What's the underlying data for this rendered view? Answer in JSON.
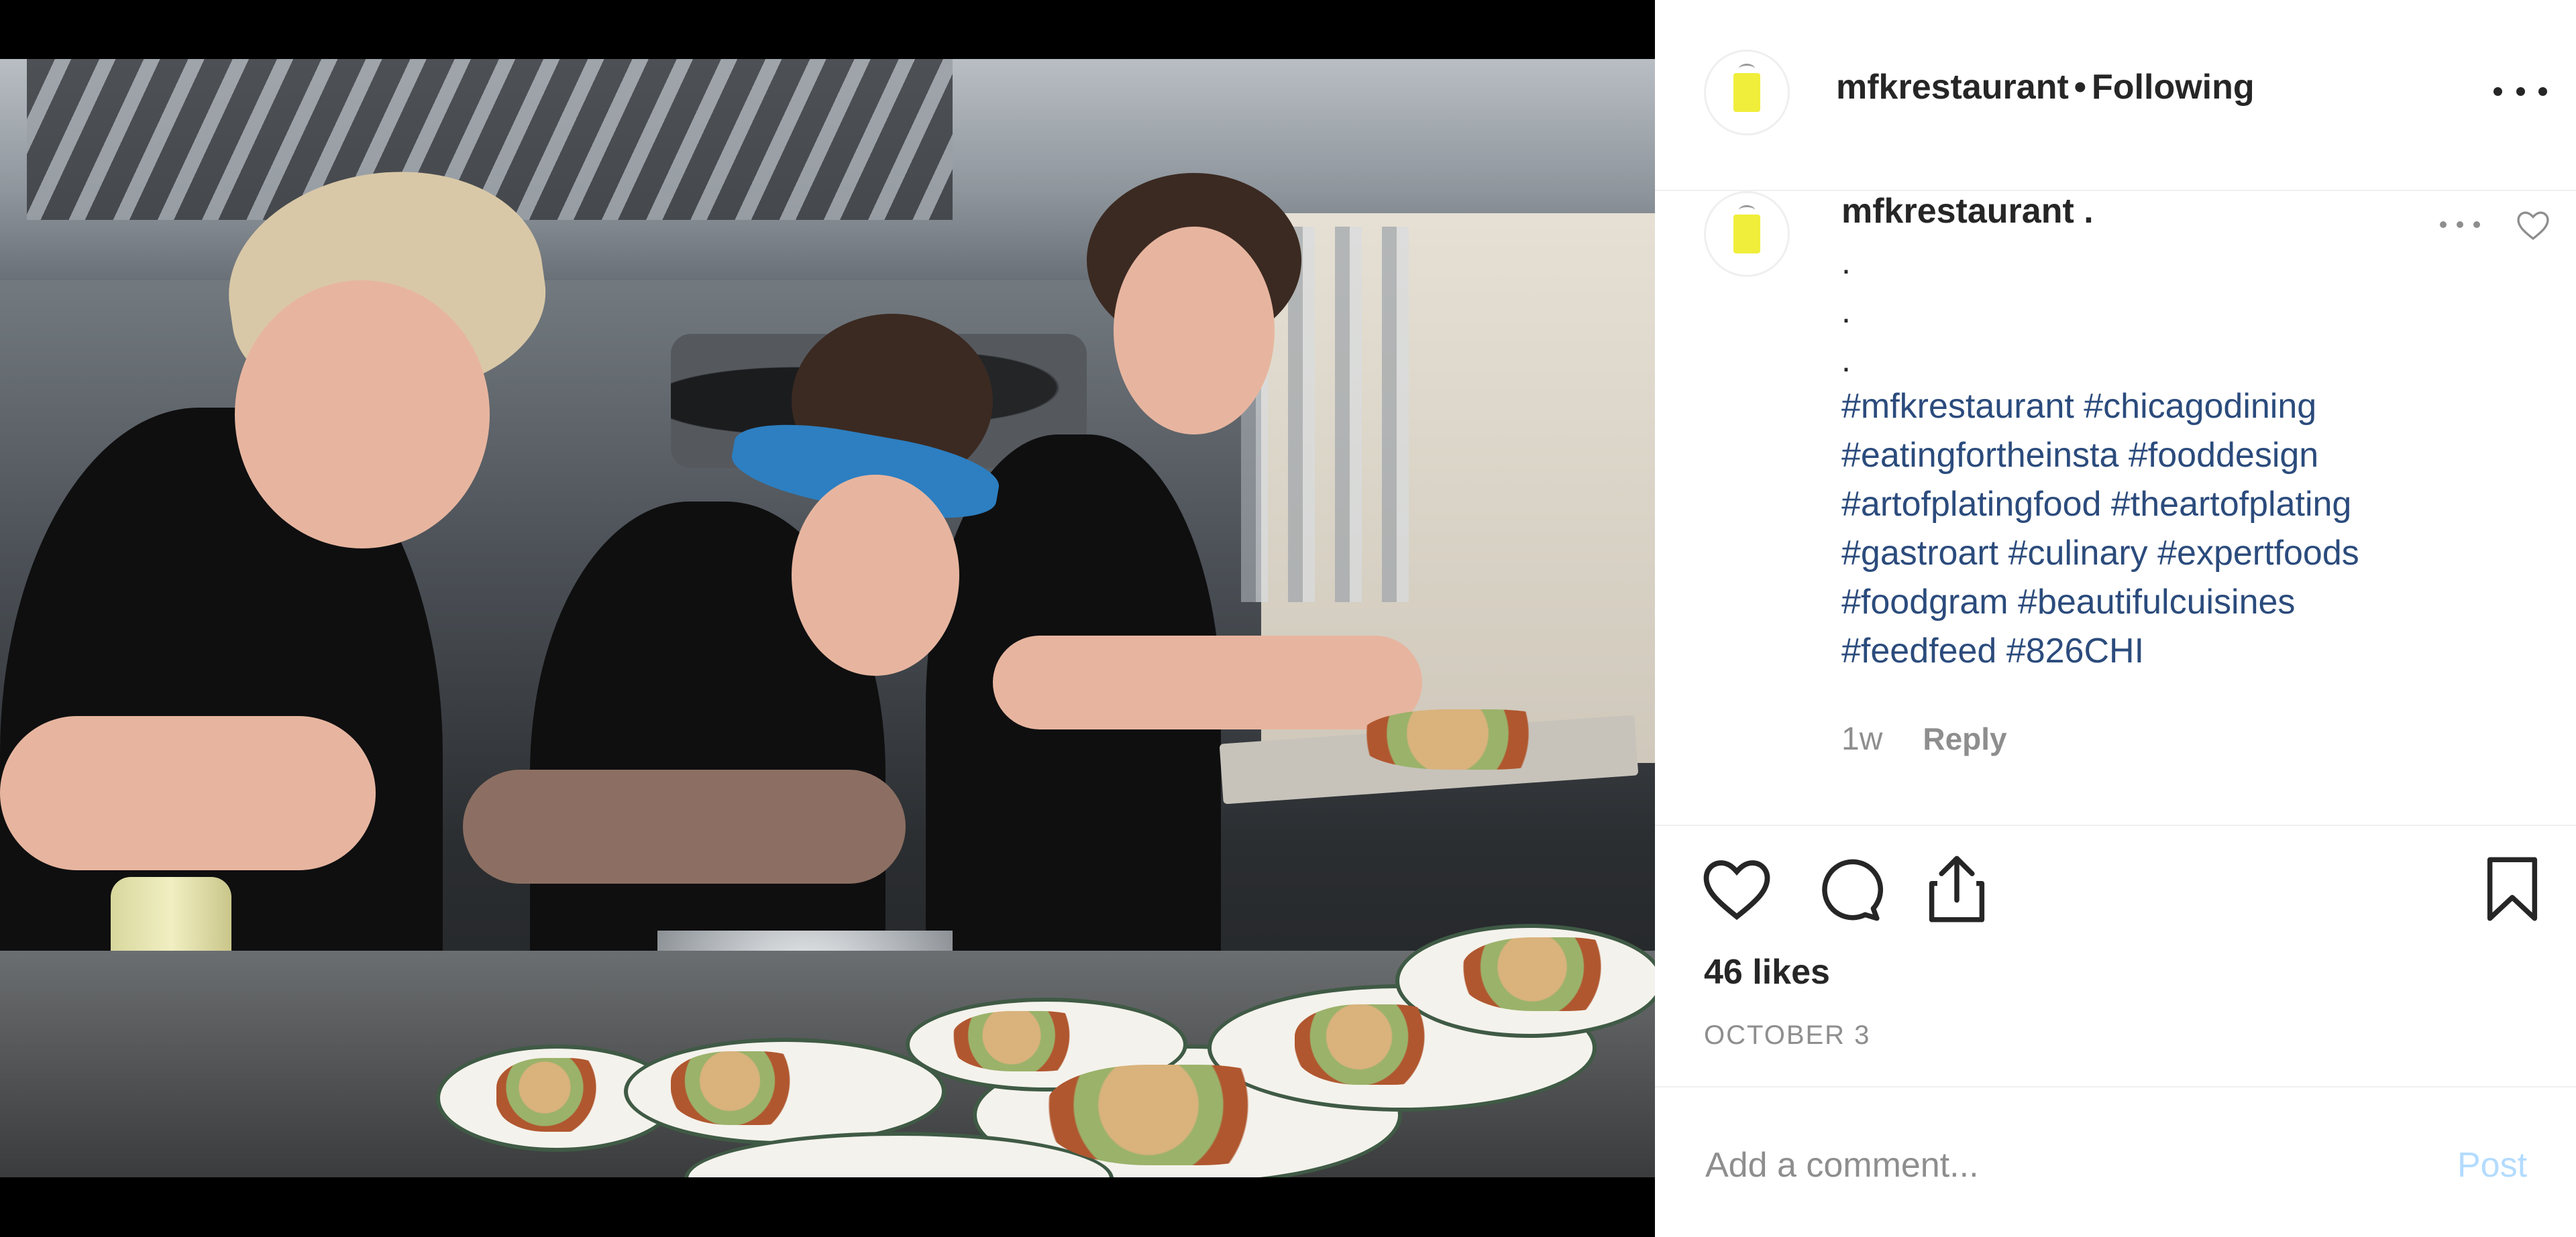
{
  "header": {
    "username": "mfkrestaurant",
    "separator": "•",
    "follow_status": "Following",
    "more_icon": "more-horizontal-icon"
  },
  "comment": {
    "username": "mfkrestaurant",
    "suffix": ".",
    "dot_lines": [
      ".",
      ".",
      "."
    ],
    "hashtag_lines": [
      "#mfkrestaurant #chicagodining",
      "#eatingfortheinsta #fooddesign",
      "#artofplatingfood #theartofplating",
      "#gastroart #culinary #expertfoods",
      "#foodgram #beautifulcuisines",
      "#feedfeed #826CHI"
    ],
    "age": "1w",
    "reply_label": "Reply",
    "more_icon": "more-horizontal-icon",
    "like_icon": "heart-outline-icon"
  },
  "actions": {
    "like_icon": "heart-outline-icon",
    "comment_icon": "comment-bubble-icon",
    "share_icon": "share-upload-icon",
    "save_icon": "bookmark-outline-icon"
  },
  "likes_text": "46 likes",
  "date_text": "OCTOBER 3",
  "comment_box": {
    "placeholder": "Add a comment...",
    "post_label": "Post"
  },
  "colors": {
    "hashtag": "#2b4b7c",
    "post_button_disabled": "#b3dbff",
    "muted_text": "#8e8e8e",
    "primary_text": "#262626"
  }
}
